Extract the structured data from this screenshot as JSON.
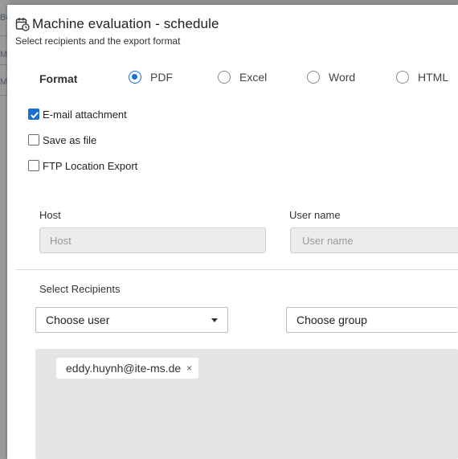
{
  "background": {
    "fragments": [
      "Be",
      "M",
      "M"
    ]
  },
  "modal": {
    "title": "Machine evaluation - schedule",
    "subtitle": "Select recipients and the export format"
  },
  "format": {
    "label": "Format",
    "options": [
      {
        "label": "PDF",
        "checked": true
      },
      {
        "label": "Excel",
        "checked": false
      },
      {
        "label": "Word",
        "checked": false
      },
      {
        "label": "HTML",
        "checked": false
      }
    ]
  },
  "delivery": [
    {
      "label": "E-mail attachment",
      "checked": true
    },
    {
      "label": "Save as file",
      "checked": false
    },
    {
      "label": "FTP Location Export",
      "checked": false
    }
  ],
  "ftp": {
    "host_label": "Host",
    "host_placeholder": "Host",
    "user_label": "User name",
    "user_placeholder": "User name"
  },
  "recipients": {
    "label": "Select Recipients",
    "user_select": "Choose user",
    "group_select": "Choose group",
    "tags": [
      "eddy.huynh@ite-ms.de"
    ]
  },
  "colors": {
    "accent": "#1a6fd1",
    "input_bg": "#ececec",
    "tag_area_bg": "#e5e5e5"
  },
  "icons": {
    "title": "calendar-clock-icon",
    "tag_remove": "close-icon",
    "select_caret": "caret-down-icon"
  }
}
